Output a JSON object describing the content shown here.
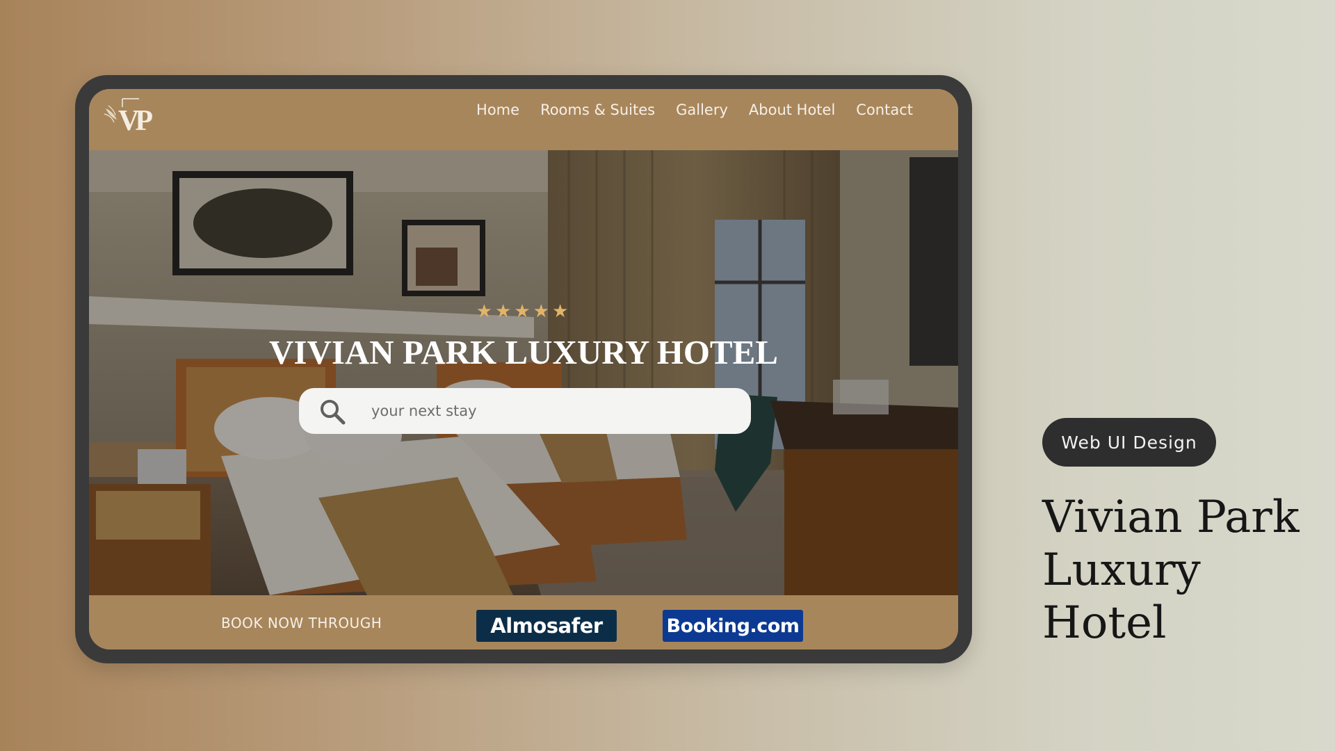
{
  "site": {
    "logo_letters": "VP",
    "nav": [
      {
        "label": "Home"
      },
      {
        "label": "Rooms & Suites"
      },
      {
        "label": "Gallery"
      },
      {
        "label": "About Hotel"
      },
      {
        "label": "Contact"
      }
    ]
  },
  "hero": {
    "stars": "★★★★★",
    "star_count": 5,
    "title": "VIVIAN PARK LUXURY HOTEL",
    "search": {
      "placeholder": "your next stay",
      "value": ""
    }
  },
  "booking": {
    "label": "BOOK NOW THROUGH",
    "partners": [
      {
        "name": "Almosafer",
        "color": "#0c2d48"
      },
      {
        "name": "Booking.com",
        "color": "#0c3a93"
      }
    ]
  },
  "showcase": {
    "tag": "Web UI Design",
    "title_line1": "Vivian Park",
    "title_line2": "Luxury Hotel"
  },
  "colors": {
    "header_gold": "#a8865b",
    "star_gold": "#e2b46a",
    "frame": "#3a3a3a",
    "pill": "#2e2e2e"
  }
}
